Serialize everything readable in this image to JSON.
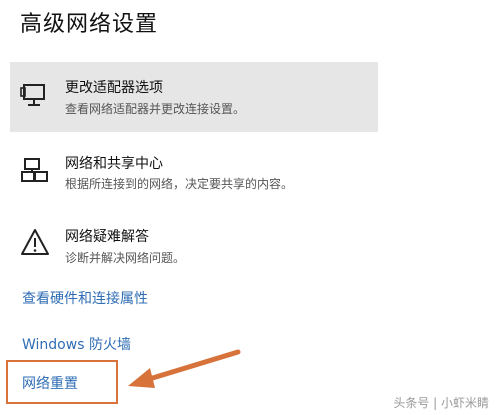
{
  "page": {
    "title": "高级网络设置"
  },
  "options": [
    {
      "title": "更改适配器选项",
      "description": "查看网络适配器并更改连接设置。",
      "icon": "monitor-icon",
      "highlighted": true
    },
    {
      "title": "网络和共享中心",
      "description": "根据所连接到的网络，决定要共享的内容。",
      "icon": "network-sharing-icon",
      "highlighted": false
    },
    {
      "title": "网络疑难解答",
      "description": "诊断并解决网络问题。",
      "icon": "warning-icon",
      "highlighted": false
    }
  ],
  "links": {
    "hardware_properties": "查看硬件和连接属性",
    "firewall": "Windows 防火墙",
    "network_reset": "网络重置"
  },
  "annotation": {
    "highlight_color": "#d6723a"
  },
  "watermark": "头条号 | 小虾米睛",
  "colors": {
    "link": "#2f6db5",
    "highlight_bg": "#e6e6e6"
  }
}
